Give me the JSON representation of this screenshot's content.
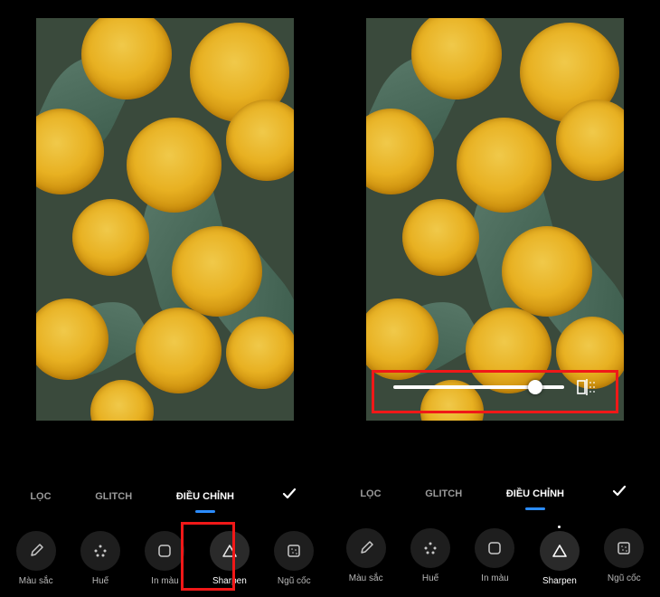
{
  "left": {
    "tabs": [
      {
        "id": "filter",
        "label": "LỌC",
        "active": false
      },
      {
        "id": "glitch",
        "label": "GLITCH",
        "active": false
      },
      {
        "id": "adjust",
        "label": "ĐIỀU CHỈNH",
        "active": true
      }
    ],
    "confirm": "✓",
    "tools": [
      {
        "id": "color",
        "label": "Màu sắc",
        "icon": "eyedropper",
        "active": false
      },
      {
        "id": "hue",
        "label": "Huế",
        "icon": "dots",
        "active": false
      },
      {
        "id": "print",
        "label": "In màu",
        "icon": "square",
        "active": false
      },
      {
        "id": "sharpen",
        "label": "Sharpen",
        "icon": "triangle",
        "active": true,
        "highlighted": true
      },
      {
        "id": "grain",
        "label": "Ngũ cốc",
        "icon": "grain",
        "active": false
      }
    ]
  },
  "right": {
    "slider": {
      "value": 83,
      "highlighted": true
    },
    "tabs": [
      {
        "id": "filter",
        "label": "LỌC",
        "active": false
      },
      {
        "id": "glitch",
        "label": "GLITCH",
        "active": false
      },
      {
        "id": "adjust",
        "label": "ĐIỀU CHỈNH",
        "active": true
      }
    ],
    "confirm": "✓",
    "tools": [
      {
        "id": "color",
        "label": "Màu sắc",
        "icon": "eyedropper",
        "active": false
      },
      {
        "id": "hue",
        "label": "Huế",
        "icon": "dots",
        "active": false
      },
      {
        "id": "print",
        "label": "In màu",
        "icon": "square",
        "active": false
      },
      {
        "id": "sharpen",
        "label": "Sharpen",
        "icon": "triangle",
        "active": true,
        "dot": true
      },
      {
        "id": "grain",
        "label": "Ngũ cốc",
        "icon": "grain",
        "active": false
      }
    ]
  }
}
